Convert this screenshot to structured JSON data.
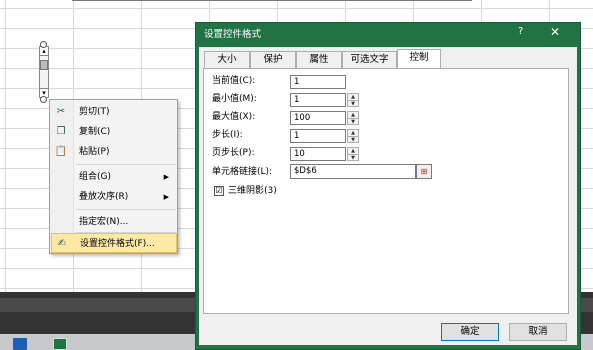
{
  "context_menu": {
    "items": [
      {
        "label": "剪切(T)",
        "icon": "scissors-icon",
        "glyph": "✂"
      },
      {
        "label": "复制(C)",
        "icon": "copy-icon",
        "glyph": "❐"
      },
      {
        "label": "粘贴(P)",
        "icon": "paste-icon",
        "glyph": "📋"
      },
      {
        "label": "组合(G)",
        "arrow": "▶"
      },
      {
        "label": "叠放次序(R)",
        "arrow": "▶"
      },
      {
        "label": "指定宏(N)..."
      },
      {
        "label": "设置控件格式(F)...",
        "icon": "format-control-icon",
        "glyph": "✍"
      }
    ]
  },
  "dialog": {
    "title": "设置控件格式",
    "help": "?",
    "close": "✕",
    "tabs": [
      "大小",
      "保护",
      "属性",
      "可选文字",
      "控制"
    ],
    "active_tab": "控制",
    "fields": {
      "current_value_label": "当前值(C):",
      "current_value": "1",
      "min_label": "最小值(M):",
      "min": "1",
      "max_label": "最大值(X):",
      "max": "100",
      "step_label": "步长(I):",
      "step": "1",
      "page_step_label": "页步长(P):",
      "page_step": "10",
      "cell_link_label": "单元格链接(L):",
      "cell_link": "$D$6",
      "shading_label": "三维阴影(3)",
      "shading_checked": "☑"
    },
    "ok_label": "确定",
    "cancel_label": "取消"
  },
  "colors": {
    "title_bar": "#217346",
    "menu_highlight": "#fde9a6"
  }
}
